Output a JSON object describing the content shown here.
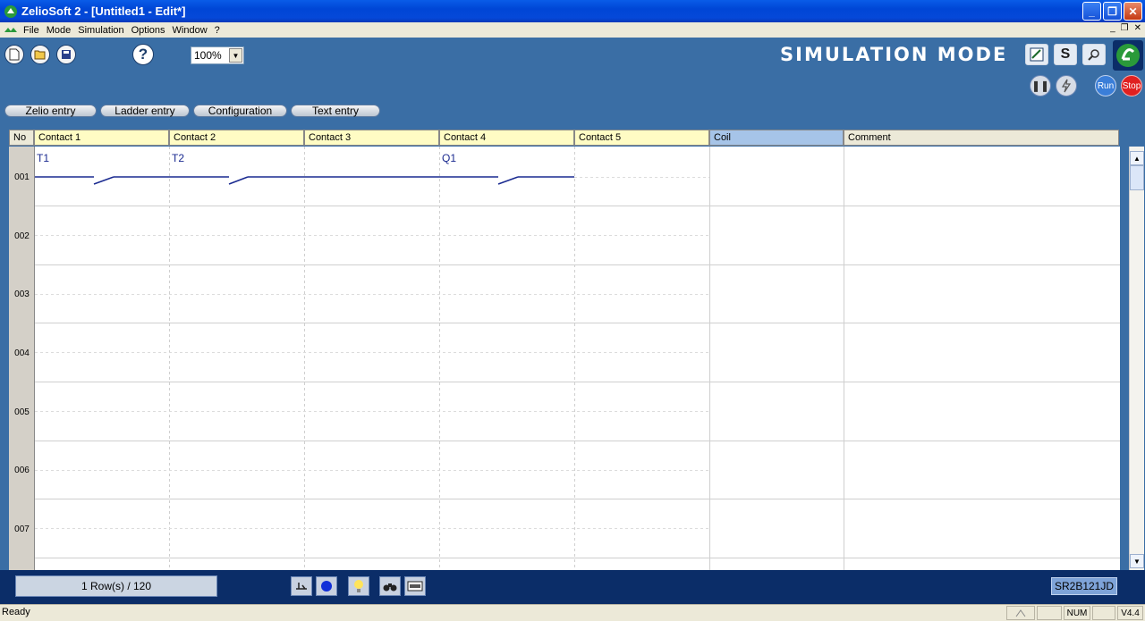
{
  "window": {
    "title": "ZelioSoft 2 - [Untitled1 - Edit*]"
  },
  "menu": {
    "items": [
      "File",
      "Mode",
      "Simulation",
      "Options",
      "Window",
      "?"
    ]
  },
  "toolbar": {
    "zoom_value": "100%",
    "mode_title": "SIMULATION MODE",
    "s_button_label": "S",
    "run_label": "Run",
    "stop_label": "Stop"
  },
  "tabs": [
    "Zelio entry",
    "Ladder entry",
    "Configuration",
    "Text entry"
  ],
  "grid": {
    "columns": [
      "No",
      "Contact 1",
      "Contact 2",
      "Contact 3",
      "Contact 4",
      "Contact 5",
      "Coil",
      "Comment"
    ],
    "row_numbers": [
      "001",
      "002",
      "003",
      "004",
      "005",
      "006",
      "007"
    ],
    "row1_contacts": [
      "T1",
      "T2",
      "",
      "Q1",
      ""
    ]
  },
  "bottom": {
    "row_count": "1 Row(s) / 120",
    "model": "SR2B121JD"
  },
  "status": {
    "text": "Ready",
    "num": "NUM",
    "version": "V4.4"
  },
  "colors": {
    "toolbar_bg": "#3a6ea5",
    "header_yellow": "#fffcc4",
    "coil_header": "#a6c4e8",
    "contact_line": "#1a2a90"
  }
}
